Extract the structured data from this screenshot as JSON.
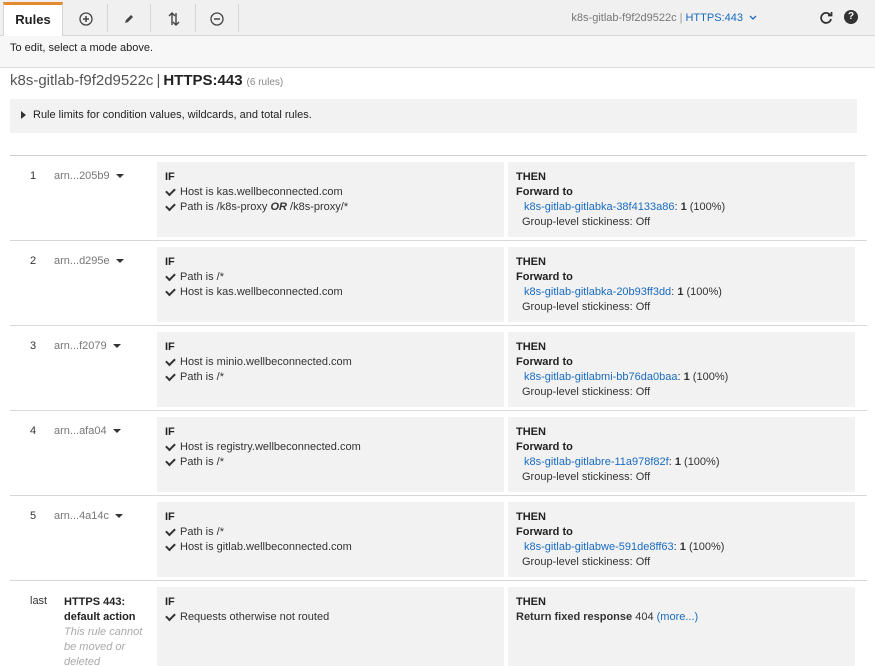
{
  "toolbar": {
    "tab_label": "Rules",
    "add_icon": "plus-circle-icon",
    "edit_icon": "pencil-icon",
    "reorder_icon": "sort-arrows-icon",
    "delete_icon": "minus-circle-icon",
    "lb_name": "k8s-gitlab-f9f2d9522c",
    "listener": "HTTPS:443",
    "refresh_icon": "refresh-icon",
    "help_label": "?"
  },
  "hint": "To edit, select a mode above.",
  "title": {
    "lb_name": "k8s-gitlab-f9f2d9522c",
    "listener": "HTTPS:443",
    "count": "(6 rules)"
  },
  "limits_label": "Rule limits for condition values, wildcards, and total rules.",
  "rules": [
    {
      "num": "1",
      "arn": "arn...205b9",
      "if_label": "IF",
      "conditions": [
        "Host is kas.wellbeconnected.com",
        "Path is /k8s-proxy",
        "OR",
        "/k8s-proxy/*"
      ],
      "then_label": "THEN",
      "action": "Forward to",
      "target": "k8s-gitlab-gitlabka-38f4133a86",
      "weight": "1",
      "percent": "(100%)",
      "stickiness": "Group-level stickiness: Off"
    },
    {
      "num": "2",
      "arn": "arn...d295e",
      "if_label": "IF",
      "conditions": [
        "Path is /*",
        "Host is kas.wellbeconnected.com"
      ],
      "then_label": "THEN",
      "action": "Forward to",
      "target": "k8s-gitlab-gitlabka-20b93ff3dd",
      "weight": "1",
      "percent": "(100%)",
      "stickiness": "Group-level stickiness: Off"
    },
    {
      "num": "3",
      "arn": "arn...f2079",
      "if_label": "IF",
      "conditions": [
        "Host is minio.wellbeconnected.com",
        "Path is /*"
      ],
      "then_label": "THEN",
      "action": "Forward to",
      "target": "k8s-gitlab-gitlabmi-bb76da0baa",
      "weight": "1",
      "percent": "(100%)",
      "stickiness": "Group-level stickiness: Off"
    },
    {
      "num": "4",
      "arn": "arn...afa04",
      "if_label": "IF",
      "conditions": [
        "Host is registry.wellbeconnected.com",
        "Path is /*"
      ],
      "then_label": "THEN",
      "action": "Forward to",
      "target": "k8s-gitlab-gitlabre-11a978f82f",
      "weight": "1",
      "percent": "(100%)",
      "stickiness": "Group-level stickiness: Off"
    },
    {
      "num": "5",
      "arn": "arn...4a14c",
      "if_label": "IF",
      "conditions": [
        "Path is /*",
        "Host is gitlab.wellbeconnected.com"
      ],
      "then_label": "THEN",
      "action": "Forward to",
      "target": "k8s-gitlab-gitlabwe-591de8ff63",
      "weight": "1",
      "percent": "(100%)",
      "stickiness": "Group-level stickiness: Off"
    }
  ],
  "last_rule": {
    "num": "last",
    "title": "HTTPS 443: default action",
    "note": "This rule cannot be moved or deleted",
    "if_label": "IF",
    "condition": "Requests otherwise not routed",
    "then_label": "THEN",
    "action": "Return fixed response",
    "code": "404",
    "more": "(more...)"
  },
  "colors": {
    "accent": "#e68a2e",
    "link": "#1a6bbf",
    "panel": "#f2f2f2"
  }
}
